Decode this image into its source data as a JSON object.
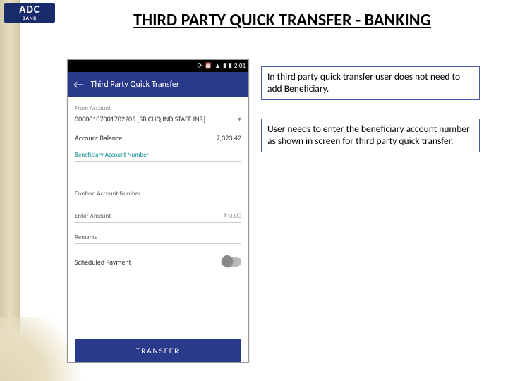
{
  "logo": {
    "top": "ADC",
    "bottom": "BANK"
  },
  "title": "THIRD PARTY QUICK TRANSFER - BANKING",
  "phone": {
    "status_time": "2:01",
    "app_title": "Third Party Quick Transfer",
    "from_label": "From Account",
    "from_value": "00000107001702205 [SB CHQ IND STAFF INR]",
    "balance_label": "Account Balance",
    "balance_value": "7,323.42",
    "beneficiary_label": "Beneficiary Account Number",
    "confirm_label": "Confirm Account Number",
    "amount_label": "Enter Amount",
    "amount_value": "₹ 0.00",
    "remarks_label": "Remarks",
    "scheduled_label": "Scheduled Payment",
    "transfer_btn": "TRANSFER"
  },
  "callouts": {
    "c1": "In third party quick transfer user does not need to add Beneficiary.",
    "c2": "User needs to enter the beneficiary account number as shown in screen for third party quick transfer."
  }
}
